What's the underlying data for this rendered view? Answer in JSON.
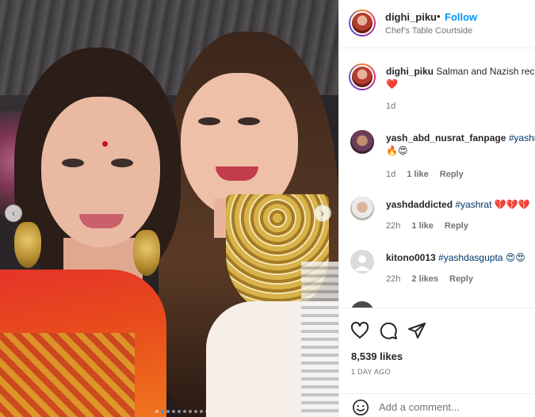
{
  "post": {
    "username": "dighi_piku",
    "separator": "•",
    "follow_label": "Follow",
    "location": "Chef's Table Courtside"
  },
  "caption": {
    "username": "dighi_piku",
    "text": "Salman and Nazish rec",
    "line2": "❤️",
    "time": "1d"
  },
  "comments": [
    {
      "username": "yash_abd_nusrat_fanpage",
      "text": "#yashrat",
      "line2": "🔥😍",
      "time": "1d",
      "likes": "1 like",
      "reply": "Reply"
    },
    {
      "username": "yashdaddicted",
      "text": "#yashrat 💔💔💔",
      "time": "22h",
      "likes": "1 like",
      "reply": "Reply"
    },
    {
      "username": "kitono0013",
      "text": "#yashdasgupta 😍😍",
      "time": "22h",
      "likes": "2 likes",
      "reply": "Reply"
    }
  ],
  "likes_count": "8,539 likes",
  "post_time": "1 DAY AGO",
  "add_comment": {
    "placeholder": "Add a comment..."
  },
  "icons": [
    "heart-icon",
    "comment-icon",
    "share-icon",
    "emoji-icon",
    "chevron-left-icon",
    "chevron-right-icon"
  ],
  "carousel": {
    "arrow_prev": "‹",
    "arrow_next": "›",
    "current_index": 1,
    "total": 10
  },
  "colors": {
    "follow": "#0095f6",
    "meta": "#737373",
    "text": "#262626",
    "hashtag": "#00376b"
  }
}
